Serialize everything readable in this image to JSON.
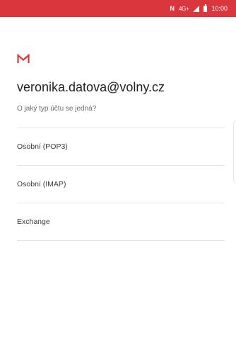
{
  "status_bar": {
    "nfc": "N",
    "network": "4G+",
    "time": "10:00",
    "color": "#d9363e"
  },
  "app": {
    "logo_icon": "gmail-m-icon",
    "email": "veronika.datova@volny.cz",
    "question": "O jaký typ účtu se jedná?"
  },
  "options": [
    {
      "label": "Osobní (POP3)"
    },
    {
      "label": "Osobní (IMAP)"
    },
    {
      "label": "Exchange"
    }
  ]
}
